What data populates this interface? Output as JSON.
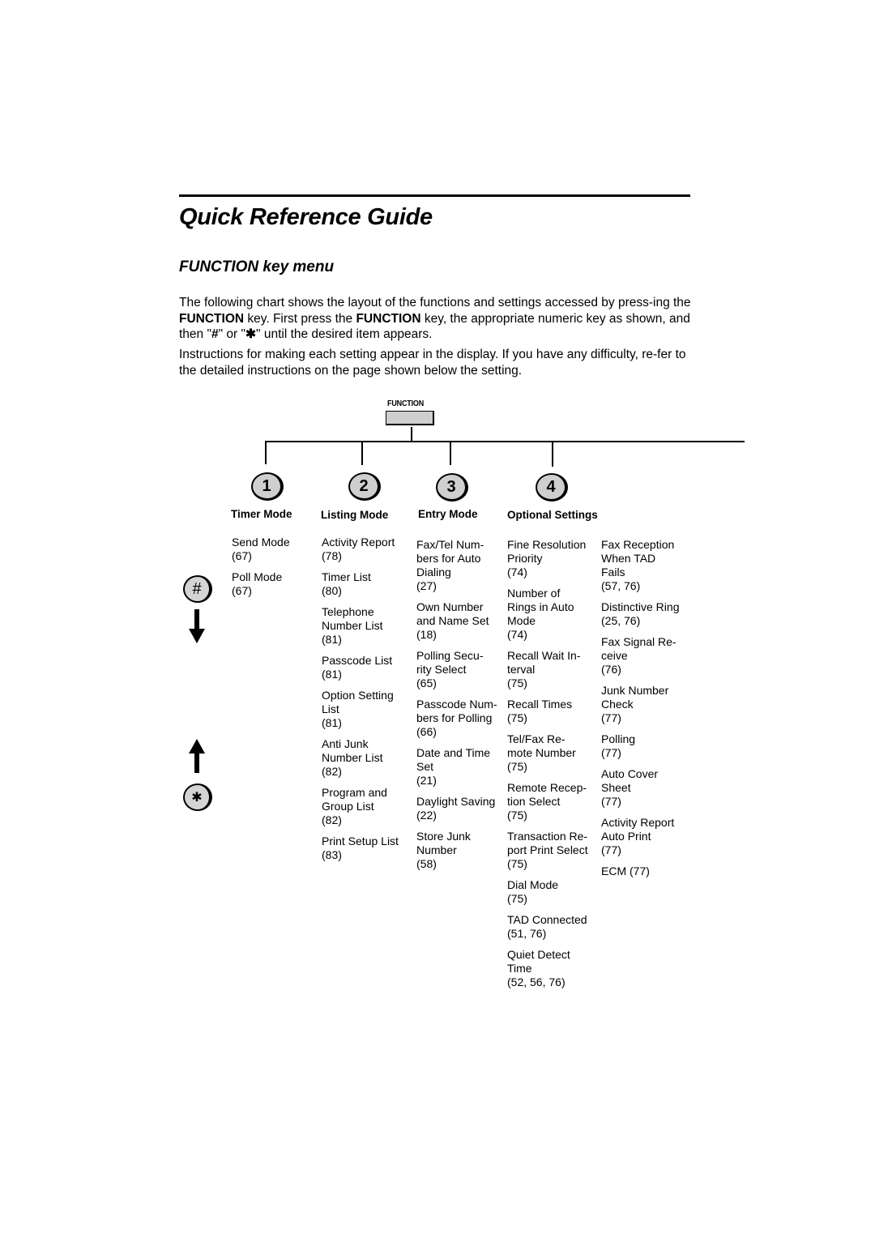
{
  "page": {
    "title": "Quick Reference Guide",
    "subtitle": "FUNCTION key menu",
    "paragraph1": {
      "part1": "The following chart shows the layout of the functions and settings accessed by press-ing the ",
      "bold1": "FUNCTION",
      "part2": " key. First press the ",
      "bold2": "FUNCTION",
      "part3": " key, the appropriate numeric key as shown,  and then \"",
      "hash": "#",
      "part4": "\" or \"",
      "star": "✱",
      "part5": "\" until the desired item appears."
    },
    "paragraph2": "Instructions for making each setting appear in the display. If you have any difficulty, re-fer to the detailed instructions on the page shown below the setting."
  },
  "diagram": {
    "function_key_label": "FUNCTION",
    "side_keys": {
      "hash_key": "#",
      "star_key": "✱",
      "down_arrow": "down-arrow",
      "up_arrow": "up-arrow"
    },
    "modes": [
      {
        "key": "1",
        "label": "Timer  Mode",
        "items": [
          {
            "name": "Send Mode",
            "page": "(67)"
          },
          {
            "name": "Poll Mode",
            "page": "(67)"
          }
        ]
      },
      {
        "key": "2",
        "label": "Listing  Mode",
        "items": [
          {
            "name": "Activity Report",
            "page": "(78)"
          },
          {
            "name": "Timer List",
            "page": "(80)"
          },
          {
            "name": "Telephone\nNumber List",
            "page": "(81)"
          },
          {
            "name": "Passcode List",
            "page": "(81)"
          },
          {
            "name": "Option Setting\nList",
            "page": "(81)"
          },
          {
            "name": "Anti Junk\nNumber List",
            "page": "(82)"
          },
          {
            "name": "Program and\nGroup List",
            "page": "(82)"
          },
          {
            "name": "Print Setup List",
            "page": "(83)"
          }
        ]
      },
      {
        "key": "3",
        "label": "Entry  Mode",
        "items": [
          {
            "name": "Fax/Tel Num-\nbers for Auto\nDialing",
            "page": "(27)"
          },
          {
            "name": "Own Number\nand Name Set",
            "page": "(18)"
          },
          {
            "name": "Polling Secu-\nrity Select",
            "page": "(65)"
          },
          {
            "name": "Passcode Num-\nbers for Polling",
            "page": "(66)"
          },
          {
            "name": "Date and Time\nSet",
            "page": "(21)"
          },
          {
            "name": "Daylight Saving",
            "page": "(22)"
          },
          {
            "name": "Store Junk\nNumber",
            "page": "(58)"
          }
        ]
      },
      {
        "key": "4",
        "label": "Optional Settings",
        "items": [
          {
            "name": "Fine Resolution\nPriority",
            "page": "(74)"
          },
          {
            "name": "Number of\nRings in Auto\nMode",
            "page": "(74)"
          },
          {
            "name": "Recall Wait In-\nterval",
            "page": "(75)"
          },
          {
            "name": "Recall Times",
            "page": "(75)"
          },
          {
            "name": "Tel/Fax Re-\nmote Number",
            "page": "(75)"
          },
          {
            "name": "Remote Recep-\ntion Select",
            "page": "(75)"
          },
          {
            "name": "Transaction Re-\nport Print Select",
            "page": "(75)"
          },
          {
            "name": "Dial Mode",
            "page": "(75)"
          },
          {
            "name": "TAD Connected",
            "page": "(51, 76)"
          },
          {
            "name": "Quiet Detect\nTime",
            "page": "(52, 56, 76)"
          }
        ],
        "items_col2": [
          {
            "name": "Fax Reception\nWhen TAD\nFails",
            "page": "(57, 76)"
          },
          {
            "name": "Distinctive Ring",
            "page": "(25, 76)"
          },
          {
            "name": "Fax Signal Re-\nceive",
            "page": "(76)"
          },
          {
            "name": "Junk Number\nCheck",
            "page": "(77)"
          },
          {
            "name": "Polling",
            "page": "(77)"
          },
          {
            "name": "Auto Cover\nSheet",
            "page": "(77)"
          },
          {
            "name": "Activity Report\nAuto Print",
            "page": "(77)"
          },
          {
            "name": "ECM (77)",
            "page": ""
          }
        ]
      }
    ]
  }
}
